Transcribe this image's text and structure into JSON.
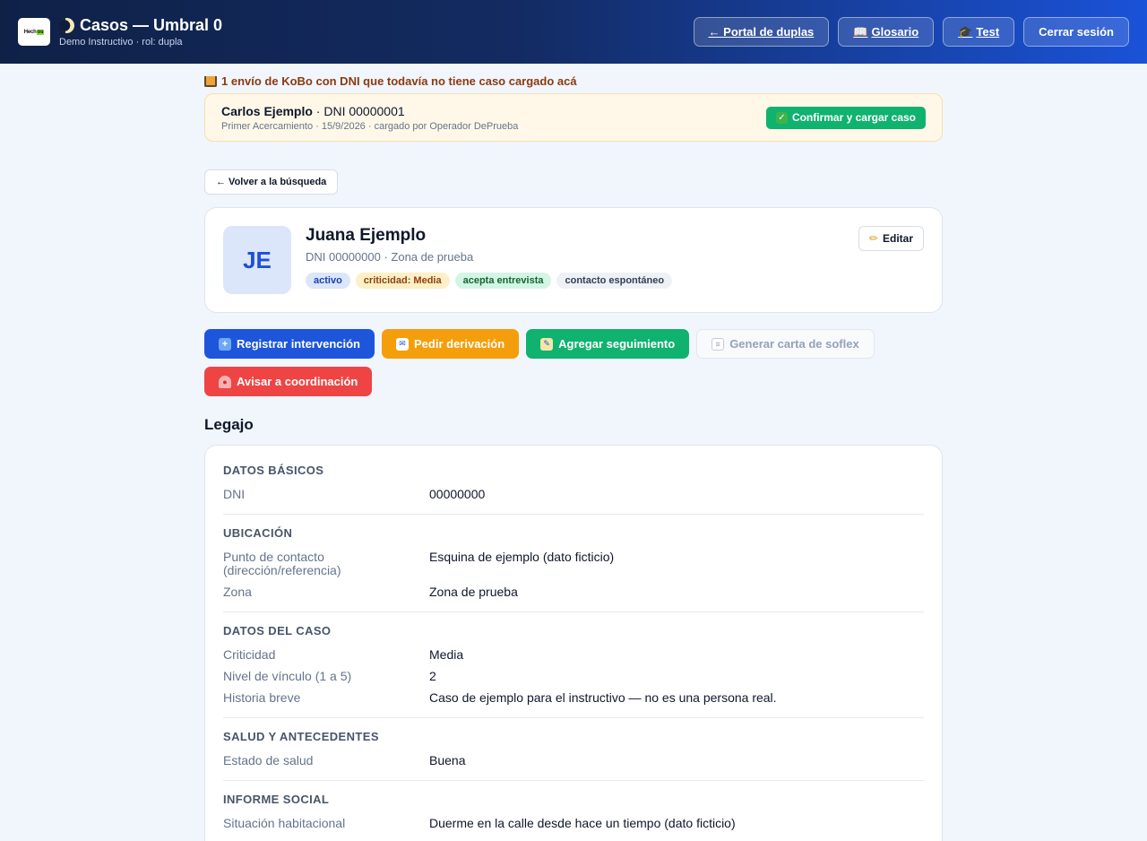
{
  "header": {
    "logo_text": "Hechos",
    "title": "Casos — Umbral 0",
    "subtitle": "Demo Instructivo · rol: dupla",
    "nav": [
      {
        "label": "← Portal de duplas"
      },
      {
        "label": "Glosario",
        "icon": "book-icon"
      },
      {
        "label": "Test",
        "icon": "graduation-cap-icon"
      },
      {
        "label": "Cerrar sesión"
      }
    ]
  },
  "kobo": {
    "notice": "1 envío de KoBo con DNI que todavía no tiene caso cargado acá",
    "name": "Carlos Ejemplo",
    "dni": " · DNI 00000001",
    "meta": "Primer Acercamiento · 15/9/2026 · cargado por Operador DePrueba",
    "confirm_label": "Confirmar y cargar caso"
  },
  "back_label": "← Volver a la búsqueda",
  "profile": {
    "initials": "JE",
    "name": "Juana Ejemplo",
    "dni_zone": "DNI 00000000 · Zona de prueba",
    "tags": [
      "activo",
      "criticidad: Media",
      "acepta entrevista",
      "contacto espontáneo"
    ],
    "edit_label": "Editar"
  },
  "actions": {
    "register": "Registrar intervención",
    "derivation": "Pedir derivación",
    "followup": "Agregar seguimiento",
    "letter": "Generar carta de soflex",
    "notify": "Avisar a coordinación"
  },
  "legajo": {
    "title": "Legajo",
    "sections": [
      {
        "head": "DATOS BÁSICOS",
        "rows": [
          {
            "label": "DNI",
            "value": "00000000"
          }
        ]
      },
      {
        "head": "UBICACIÓN",
        "rows": [
          {
            "label": "Punto de contacto (dirección/referencia)",
            "value": "Esquina de ejemplo (dato ficticio)"
          },
          {
            "label": "Zona",
            "value": "Zona de prueba"
          }
        ]
      },
      {
        "head": "DATOS DEL CASO",
        "rows": [
          {
            "label": "Criticidad",
            "value": "Media"
          },
          {
            "label": "Nivel de vínculo (1 a 5)",
            "value": "2"
          },
          {
            "label": "Historia breve",
            "value": "Caso de ejemplo para el instructivo — no es una persona real."
          }
        ]
      },
      {
        "head": "SALUD Y ANTECEDENTES",
        "rows": [
          {
            "label": "Estado de salud",
            "value": "Buena"
          }
        ]
      },
      {
        "head": "INFORME SOCIAL",
        "rows": [
          {
            "label": "Situación habitacional",
            "value": "Duerme en la calle desde hace un tiempo (dato ficticio)"
          }
        ]
      }
    ]
  }
}
